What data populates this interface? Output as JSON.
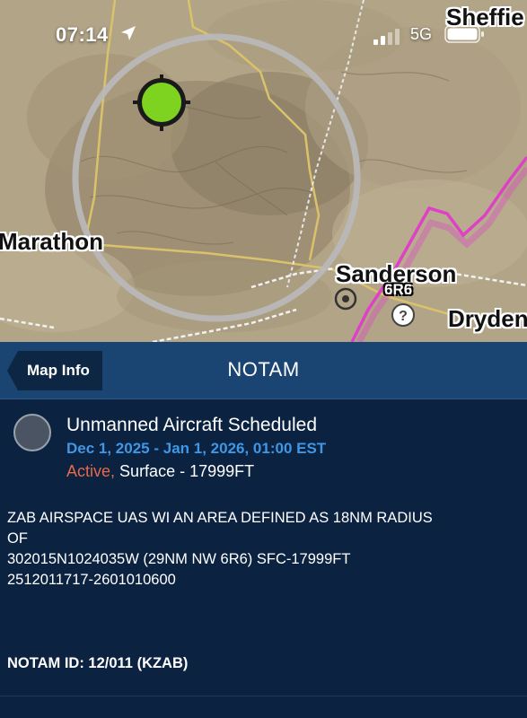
{
  "status_bar": {
    "time": "07:14",
    "network": "5G"
  },
  "map": {
    "labels": {
      "marathon": "Marathon",
      "sheffield": "Sheffie",
      "sanderson": "Sanderson",
      "dryden": "Dryden",
      "airport_6r6": "6R6"
    },
    "colors": {
      "airspace_boundary": "#e040c8",
      "notam_circle": "#b8b8b8",
      "location_marker": "#7ed321"
    }
  },
  "panel": {
    "back_label": "Map Info",
    "title": "NOTAM",
    "notam": {
      "type": "Unmanned Aircraft Scheduled",
      "dates": "Dec 1, 2025 - Jan 1, 2026, 01:00 EST",
      "status": "Active,",
      "altitude": "Surface - 17999FT",
      "text_lines": [
        "ZAB AIRSPACE UAS WI AN AREA DEFINED AS 18NM RADIUS",
        "OF",
        "302015N1024035W (29NM NW 6R6) SFC-17999FT",
        "2512011717-2601010600"
      ],
      "id": "NOTAM ID: 12/011 (KZAB)"
    },
    "colors": {
      "header_bg": "#1a4472",
      "body_bg": "#0b2240",
      "dates": "#3f97e6",
      "active": "#e8694a"
    }
  }
}
